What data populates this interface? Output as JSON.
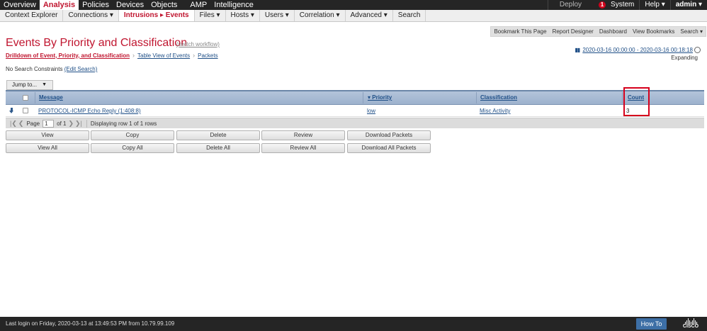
{
  "topnav": {
    "items": [
      "Overview",
      "Analysis",
      "Policies",
      "Devices",
      "Objects",
      "AMP",
      "Intelligence"
    ],
    "active_index": 1,
    "deploy": "Deploy",
    "alert_count": "1",
    "system": "System",
    "help": "Help ▾",
    "user": "admin ▾"
  },
  "subnav": {
    "items": [
      "Context Explorer",
      "Connections ▾",
      "Intrusions ▸ Events",
      "Files ▾",
      "Hosts ▾",
      "Users ▾",
      "Correlation ▾",
      "Advanced ▾",
      "Search"
    ],
    "active_index": 2
  },
  "toolbar": {
    "items": [
      "Bookmark This Page",
      "Report Designer",
      "Dashboard",
      "View Bookmarks",
      "Search ▾"
    ]
  },
  "page": {
    "title": "Events By Priority and Classification",
    "switch_workflow": "(switch workflow)"
  },
  "breadcrumb": {
    "items": [
      "Drilldown of Event, Priority, and Classification",
      "Table View of Events",
      "Packets"
    ]
  },
  "timerange": {
    "range": "2020-03-16 00:00:00 - 2020-03-16 00:18:18",
    "mode": "Expanding"
  },
  "constraints": {
    "text": "No Search Constraints",
    "edit": "(Edit Search)"
  },
  "jump": {
    "label": "Jump to...",
    "arrow": "▼"
  },
  "table": {
    "columns": {
      "message": "Message",
      "priority": "▾ Priority",
      "classification": "Classification",
      "count": "Count"
    },
    "rows": [
      {
        "message": "PROTOCOL-ICMP Echo Reply (1:408:8)",
        "priority": "low",
        "classification": "Misc Activity",
        "count": "3"
      }
    ]
  },
  "pager": {
    "page_label": "Page",
    "page_value": "1",
    "of_label": "of 1",
    "status": "Displaying row 1 of 1 rows"
  },
  "buttons": {
    "row1": [
      "View",
      "Copy",
      "Delete",
      "Review",
      "Download Packets"
    ],
    "row2": [
      "View All",
      "Copy All",
      "Delete All",
      "Review All",
      "Download All Packets"
    ]
  },
  "footer": {
    "last_login": "Last login on Friday, 2020-03-13 at 13:49:53 PM from 10.79.99.109",
    "howto": "How To",
    "brand": "CISCO"
  }
}
